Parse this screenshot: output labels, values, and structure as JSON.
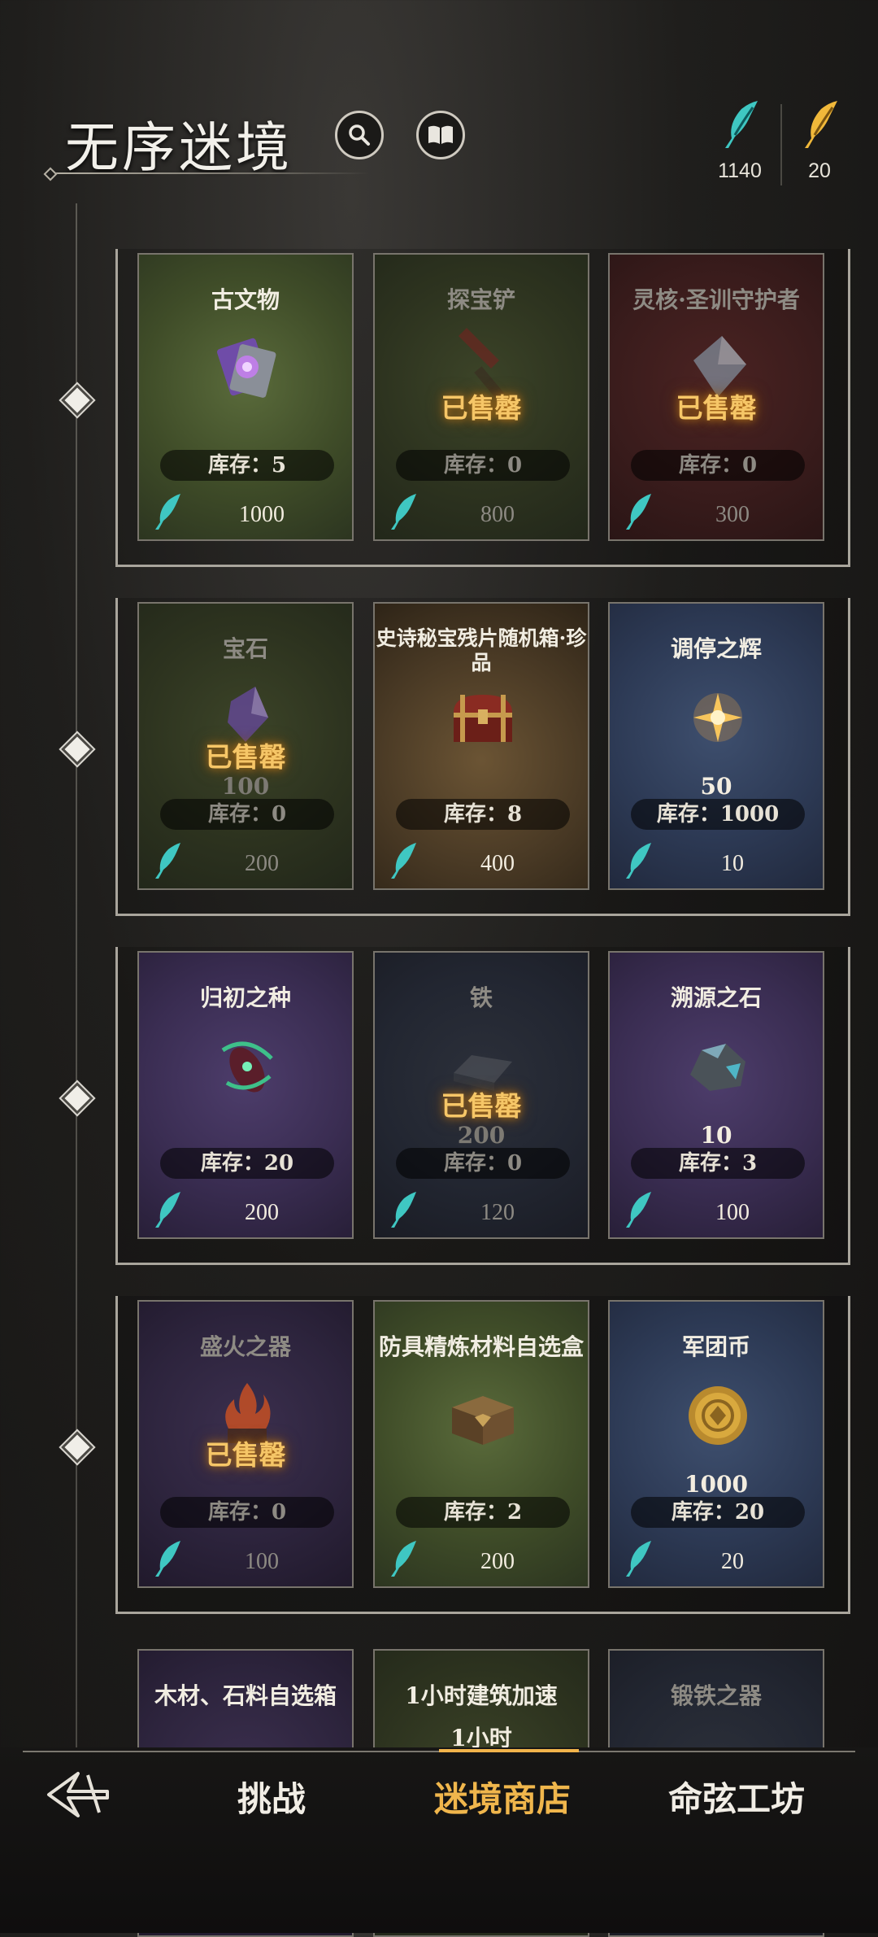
{
  "header": {
    "title": "无序迷境"
  },
  "currency": [
    {
      "name": "blue-quill",
      "amount": "1140",
      "color": "#3fc7c2"
    },
    {
      "name": "gold-quill",
      "amount": "20",
      "color": "#f0b83a"
    }
  ],
  "shop": {
    "stock_prefix": "库存：",
    "sold_out_label": "已售罄",
    "items": [
      {
        "name": "古文物",
        "qty": "",
        "stock": "库存：5",
        "price": "1000",
        "sold": false
      },
      {
        "name": "探宝铲",
        "qty": "",
        "stock": "库存：0",
        "price": "800",
        "sold": true
      },
      {
        "name": "灵核·圣训守护者",
        "qty": "",
        "stock": "库存：0",
        "price": "300",
        "sold": true
      },
      {
        "name": "宝石",
        "qty": "100",
        "stock": "库存：0",
        "price": "200",
        "sold": true
      },
      {
        "name": "史诗秘宝残片随机箱·珍品",
        "qty": "",
        "stock": "库存：8",
        "price": "400",
        "sold": false
      },
      {
        "name": "调停之辉",
        "qty": "50",
        "stock": "库存：1000",
        "price": "10",
        "sold": false
      },
      {
        "name": "归初之种",
        "qty": "",
        "stock": "库存：20",
        "price": "200",
        "sold": false
      },
      {
        "name": "铁",
        "qty": "200",
        "stock": "库存：0",
        "price": "120",
        "sold": true
      },
      {
        "name": "溯源之石",
        "qty": "10",
        "stock": "库存：3",
        "price": "100",
        "sold": false
      },
      {
        "name": "盛火之器",
        "qty": "",
        "stock": "库存：0",
        "price": "100",
        "sold": true
      },
      {
        "name": "防具精炼材料自选盒",
        "qty": "",
        "stock": "库存：2",
        "price": "200",
        "sold": false
      },
      {
        "name": "军团币",
        "qty": "1000",
        "stock": "库存：20",
        "price": "20",
        "sold": false
      },
      {
        "name": "木材、石料自选箱",
        "qty": "",
        "stock": "",
        "price": "",
        "sold": false
      },
      {
        "name": "1小时建筑加速",
        "qty": "1小时",
        "stock": "",
        "price": "",
        "sold": false
      },
      {
        "name": "锻铁之器",
        "qty": "",
        "stock": "",
        "price": "",
        "sold": true
      }
    ]
  },
  "nav": {
    "tabs": [
      {
        "label": "挑战",
        "active": false
      },
      {
        "label": "迷境商店",
        "active": true
      },
      {
        "label": "命弦工坊",
        "active": false
      }
    ]
  }
}
